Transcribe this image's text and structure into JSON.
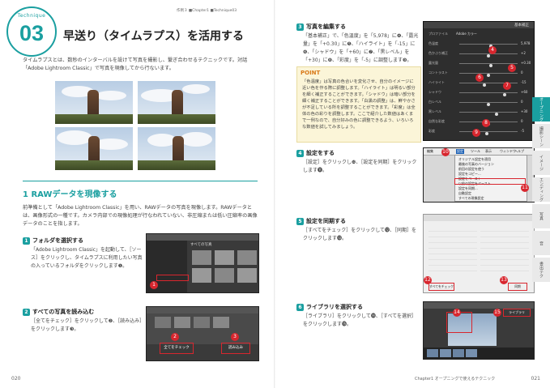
{
  "header": {
    "breadcrumb": "作例３ ■Chapter1 ■Technique03"
  },
  "technique": {
    "label": "Technique",
    "number": "03"
  },
  "title": "早送り（タイムラプス）を活用する",
  "intro": "タイムラプスとは、数秒のインターバルを設けて写真を撮影し、繋ぎ合わせるテクニックです。対話「Adobe Lightroom Classic」で写真を現像してから行ないます。",
  "section": {
    "heading": "1  RAWデータを現像する",
    "body": "前準備として「Adobe Lightroom Classic」を用い、RAWデータの写真を現像します。RAWデータとは、画像形式の一種です。カメラ内部での現像処理が行なわれていない、非圧縮または低い圧縮率の画像データのことを指します。"
  },
  "left_steps": [
    {
      "num": "1",
      "heading": "フォルダを選択する",
      "body": "「Adobe Lightroom Classic」を起動して、［ソース］をクリックし、タイムラプスに利用したい写真の入っているフォルダをクリックします❶。",
      "callouts": [
        "1"
      ],
      "shot_title": "すべての写真"
    },
    {
      "num": "2",
      "heading": "すべての写真を読み込む",
      "body": "［全てをチェック］をクリックして❷、［読み込み］をクリックします❸。",
      "callouts": [
        "2",
        "3"
      ],
      "buttons": [
        "全てをチェック",
        "読み込み"
      ]
    }
  ],
  "right_steps": [
    {
      "num": "3",
      "heading": "写真を編集する",
      "body": "「基本補正」で、「色温度」を「5,978」に❹、「露光量」を「+0.30」に❺、「ハイライト」を「-15」に❻、「シャドウ」を「+60」に❼、「黒レベル」を「+30」に❽、「彩度」を「-5」に調整します❾。"
    },
    {
      "num": "4",
      "heading": "設定をする",
      "body": "［設定］をクリックし❿、［設定を同期］をクリックします⓫。"
    },
    {
      "num": "5",
      "heading": "設定を同期する",
      "body": "［すべてをチェック］をクリックして⓬、［同期］をクリックします⓭。"
    },
    {
      "num": "6",
      "heading": "ライブラリを選択する",
      "body": "［ライブラリ］をクリックして⓮、［すべてを選択］をクリックします⓯。"
    }
  ],
  "point": {
    "title": "POINT",
    "text": "「色温度」は写真の色合いを変化させ、自分のイメージに近い色を作る際に調整します。「ハイライト」は明るい部分を細く補正することができます。「シャドウ」は暗い部分を細く補正することができます。「白黒の調整」は、鮮やかさが不足している所を調整することができます。「彩度」は全体の色の彩りを調整します。ここで紹介した数値はあくまで一例なので、自分好みの色に調整できるよう、いろいろな数値を試してみましょう。"
  },
  "panel": {
    "title": "基本補正",
    "profile_label": "プロファイル",
    "profile_value": "Adobe カラー",
    "rows": [
      {
        "label": "色温度",
        "value": "5,978",
        "pos": 0.55
      },
      {
        "label": "色かぶり補正",
        "value": "+2",
        "pos": 0.5
      },
      {
        "label": "露光量",
        "value": "+0.30",
        "pos": 0.55
      },
      {
        "label": "コントラスト",
        "value": "0",
        "pos": 0.5
      },
      {
        "label": "ハイライト",
        "value": "-15",
        "pos": 0.42
      },
      {
        "label": "シャドウ",
        "value": "+60",
        "pos": 0.8
      },
      {
        "label": "白レベル",
        "value": "0",
        "pos": 0.5
      },
      {
        "label": "黒レベル",
        "value": "+30",
        "pos": 0.65
      },
      {
        "label": "自然な彩度",
        "value": "0",
        "pos": 0.5
      },
      {
        "label": "彩度",
        "value": "-5",
        "pos": 0.47
      }
    ],
    "callouts": [
      "4",
      "5",
      "6",
      "7",
      "8",
      "9"
    ]
  },
  "menu": {
    "bar": [
      "編集",
      "写真",
      "設定",
      "ツール",
      "表示",
      "ウィンドウ",
      "ヘルプ"
    ],
    "items": [
      "オリジナル設定を適用",
      "最後の写真のバージョン",
      "前回の設定を使う",
      "設定をコピー...",
      "設定をペースト",
      "以前の設定をペースト",
      "設定を同期...",
      "自動設定",
      "すべての現像設定"
    ],
    "callouts": [
      "10",
      "11"
    ]
  },
  "sync_dialog": {
    "buttons": [
      "すべてをチェック",
      "同期"
    ],
    "callouts": [
      "12",
      "13"
    ]
  },
  "library_shot": {
    "tab": "ライブラリ",
    "callouts": [
      "14",
      "15"
    ]
  },
  "side_tabs": [
    "オープニング",
    "撮影シーン",
    "イメージ",
    "エンディング",
    "写真",
    "音",
    "書出テク"
  ],
  "footer": {
    "left_page": "020",
    "right_page": "021",
    "chapter": "Chapter1 オープニングで使えるテクニック"
  }
}
